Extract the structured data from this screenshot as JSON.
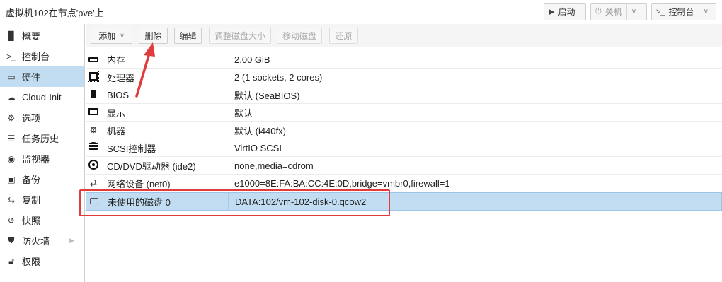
{
  "window": {
    "title": "虚拟机102在节点'pve'上",
    "start_label": "启动",
    "shutdown_label": "关机",
    "console_label": "控制台"
  },
  "sidebar": {
    "items": [
      {
        "label": "概要",
        "icon": "book-icon"
      },
      {
        "label": "控制台",
        "icon": "terminal-icon"
      },
      {
        "label": "硬件",
        "icon": "monitor-icon",
        "active": true
      },
      {
        "label": "Cloud-Init",
        "icon": "cloud-icon"
      },
      {
        "label": "选项",
        "icon": "gear-icon"
      },
      {
        "label": "任务历史",
        "icon": "list-icon"
      },
      {
        "label": "监视器",
        "icon": "eye-icon"
      },
      {
        "label": "备份",
        "icon": "floppy-icon"
      },
      {
        "label": "复制",
        "icon": "retweet-icon"
      },
      {
        "label": "快照",
        "icon": "history-icon"
      },
      {
        "label": "防火墙",
        "icon": "shield-icon"
      },
      {
        "label": "权限",
        "icon": "unlock-icon"
      }
    ]
  },
  "toolbar": {
    "add_label": "添加",
    "delete_label": "删除",
    "edit_label": "编辑",
    "resize_label": "调整磁盘大小",
    "move_label": "移动磁盘",
    "revert_label": "还原"
  },
  "hardware": {
    "rows": [
      {
        "key": "内存",
        "value": "2.00 GiB",
        "icon": "memory-icon"
      },
      {
        "key": "处理器",
        "value": "2 (1 sockets, 2 cores)",
        "icon": "cpu-icon"
      },
      {
        "key": "BIOS",
        "value": "默认 (SeaBIOS)",
        "icon": "bios-icon"
      },
      {
        "key": "显示",
        "value": "默认",
        "icon": "display-icon"
      },
      {
        "key": "机器",
        "value": "默认 (i440fx)",
        "icon": "cogs-icon"
      },
      {
        "key": "SCSI控制器",
        "value": "VirtIO SCSI",
        "icon": "database-icon"
      },
      {
        "key": "CD/DVD驱动器 (ide2)",
        "value": "none,media=cdrom",
        "icon": "cdrom-icon"
      },
      {
        "key": "网络设备 (net0)",
        "value": "e1000=8E:FA:BA:CC:4E:0D,bridge=vmbr0,firewall=1",
        "icon": "exchange-icon"
      },
      {
        "key": "未使用的磁盘 0",
        "value": "DATA:102/vm-102-disk-0.qcow2",
        "icon": "hdd-icon",
        "selected": true
      }
    ]
  },
  "colors": {
    "selection": "#c2ddf2",
    "annotation": "#e13b3b"
  }
}
